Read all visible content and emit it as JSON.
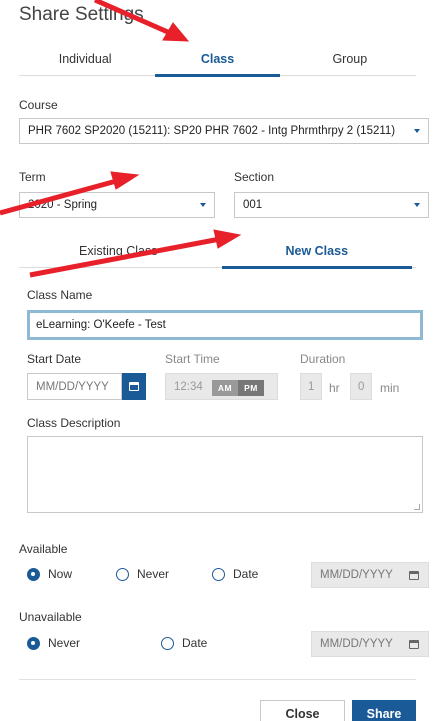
{
  "dialog": {
    "title": "Share Settings"
  },
  "share_tabs": [
    {
      "label": "Individual",
      "active": false
    },
    {
      "label": "Class",
      "active": true
    },
    {
      "label": "Group",
      "active": false
    }
  ],
  "course": {
    "label": "Course",
    "value": "PHR 7602 SP2020 (15211): SP20 PHR 7602 - Intg Phrmthrpy 2 (15211)"
  },
  "term": {
    "label": "Term",
    "value": "2020 - Spring"
  },
  "section": {
    "label": "Section",
    "value": "001"
  },
  "class_tabs": [
    {
      "label": "Existing Class",
      "active": false
    },
    {
      "label": "New Class",
      "active": true
    }
  ],
  "new_class": {
    "name_label": "Class Name",
    "name_value": "eLearning: O'Keefe - Test",
    "start_date_label": "Start Date",
    "start_date_placeholder": "MM/DD/YYYY",
    "start_time_label": "Start Time",
    "start_time_value": "12:34",
    "am_label": "AM",
    "pm_label": "PM",
    "duration_label": "Duration",
    "duration_hr_value": "1",
    "duration_hr_unit": "hr",
    "duration_min_value": "0",
    "duration_min_unit": "min",
    "description_label": "Class Description"
  },
  "available": {
    "label": "Available",
    "options": [
      {
        "label": "Now",
        "selected": true
      },
      {
        "label": "Never",
        "selected": false
      },
      {
        "label": "Date",
        "selected": false
      }
    ],
    "date_placeholder": "MM/DD/YYYY"
  },
  "unavailable": {
    "label": "Unavailable",
    "options": [
      {
        "label": "Never",
        "selected": true
      },
      {
        "label": "Date",
        "selected": false
      }
    ],
    "date_placeholder": "MM/DD/YYYY"
  },
  "footer": {
    "close_label": "Close",
    "share_label": "Share"
  },
  "colors": {
    "accent": "#1a5a96",
    "annotation_arrow": "#e8202a"
  },
  "icons": [
    "calendar-icon",
    "caret-down-icon",
    "radio-icon",
    "arrow-annotation"
  ]
}
